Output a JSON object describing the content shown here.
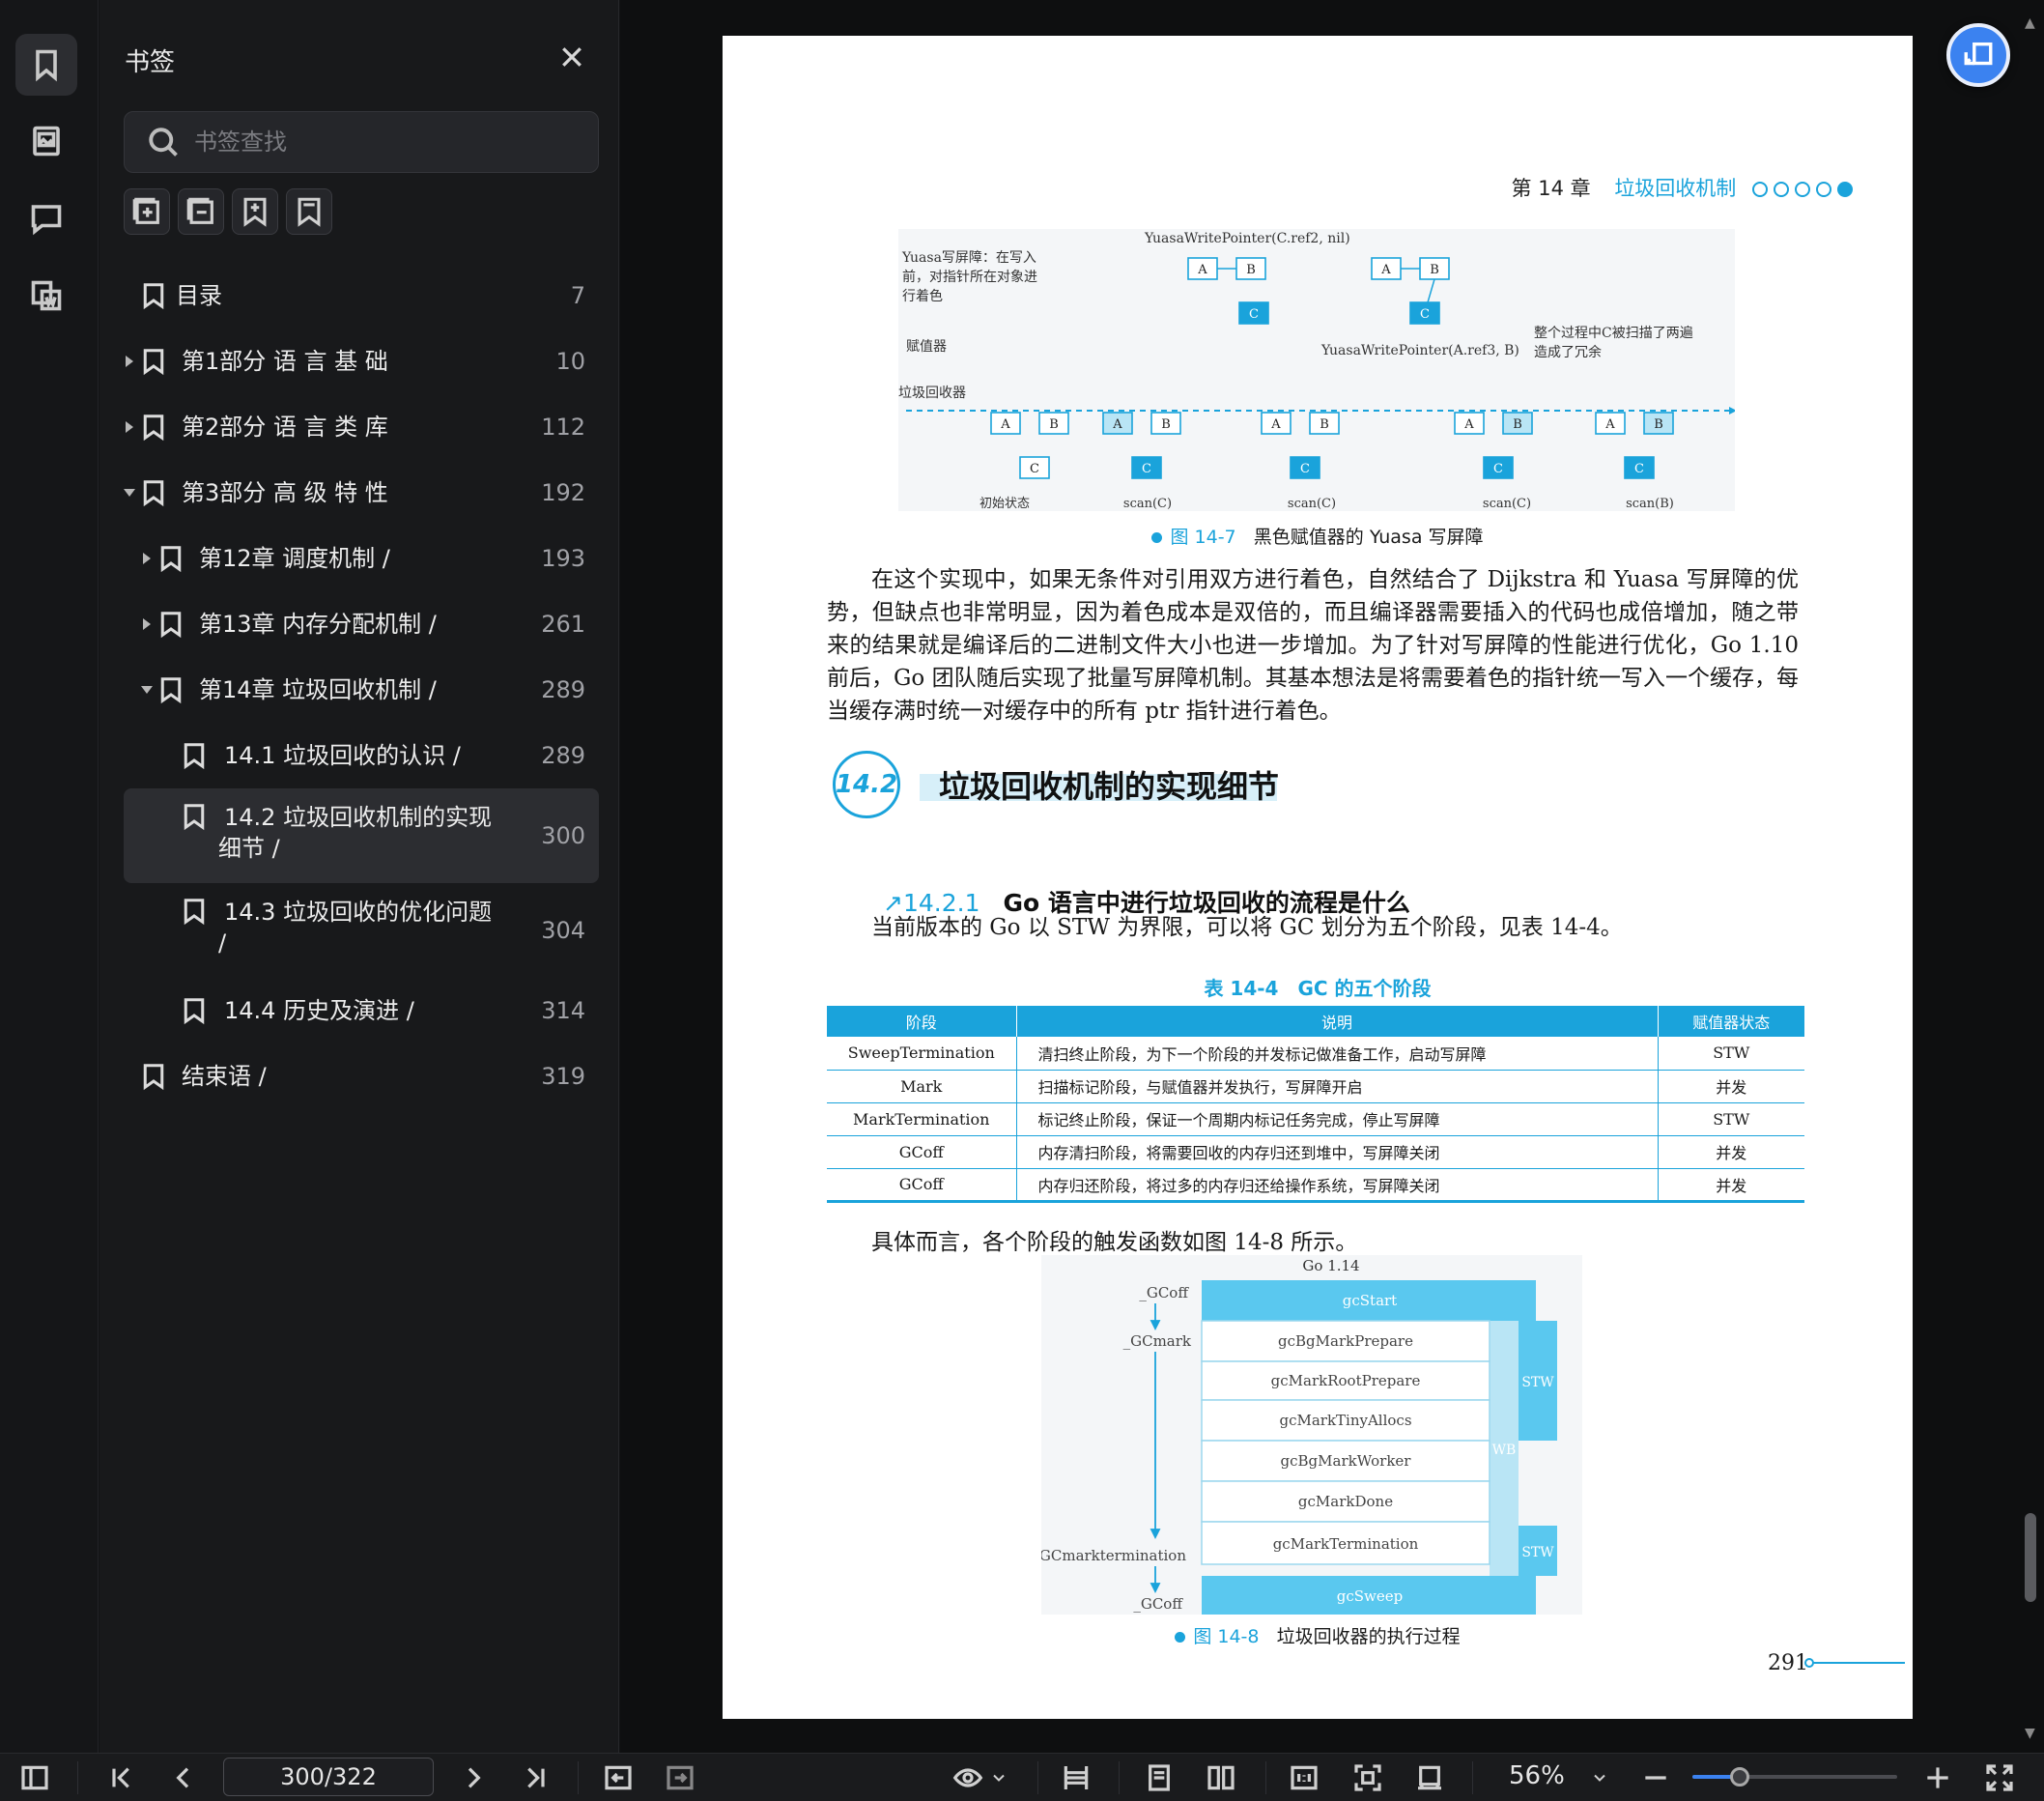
{
  "panel": {
    "title": "书签",
    "search_placeholder": "书签查找"
  },
  "bookmarks": [
    {
      "label": "目录",
      "page": "7",
      "level": 0,
      "expand": "none"
    },
    {
      "label": "第1部分 语 言 基 础",
      "page": "10",
      "level": 0,
      "expand": "collapsed"
    },
    {
      "label": "第2部分 语 言 类 库",
      "page": "112",
      "level": 0,
      "expand": "collapsed"
    },
    {
      "label": "第3部分 高 级 特 性",
      "page": "192",
      "level": 0,
      "expand": "expanded"
    },
    {
      "label": "第12章 调度机制 /",
      "page": "193",
      "level": 1,
      "expand": "collapsed"
    },
    {
      "label": "第13章 内存分配机制 /",
      "page": "261",
      "level": 1,
      "expand": "collapsed"
    },
    {
      "label": "第14章 垃圾回收机制 /",
      "page": "289",
      "level": 1,
      "expand": "expanded"
    },
    {
      "label": "14.1 垃圾回收的认识 /",
      "page": "289",
      "level": 2,
      "expand": "none"
    },
    {
      "label": "14.2 垃圾回收机制的实现细节 /",
      "page": "300",
      "level": 2,
      "expand": "none",
      "selected": true,
      "line1": "14.2 垃圾回收机制的实现",
      "line2": "细节 /"
    },
    {
      "label": "14.3 垃圾回收的优化问题 /",
      "page": "304",
      "level": 2,
      "expand": "none",
      "line1": "14.3 垃圾回收的优化问题",
      "line2": "/"
    },
    {
      "label": "14.4 历史及演进 /",
      "page": "314",
      "level": 2,
      "expand": "none"
    },
    {
      "label": "结束语 /",
      "page": "319",
      "level": 0,
      "expand": "none"
    }
  ],
  "page": {
    "chapter_no": "第 14 章",
    "chapter_title": "垃圾回收机制",
    "fig1": {
      "note_left": [
        "Yuasa写屏障：在写入",
        "前，对指针所在对象进",
        "行着色"
      ],
      "call_top": "YuasaWritePointer(C.ref2, nil)",
      "label_mutator": "赋值器",
      "call_mid": "YuasaWritePointer(A.ref3, B)",
      "note_right": [
        "整个过程中C被扫描了两遍",
        "造成了冗余"
      ],
      "label_gc": "垃圾回收器",
      "steps": [
        "初始状态",
        "scan(C)",
        "scan(C)",
        "scan(C)",
        "scan(B)"
      ],
      "caption_num": "图 14-7",
      "caption_text": "黑色赋值器的 Yuasa 写屏障"
    },
    "para1": "在这个实现中，如果无条件对引用双方进行着色，自然结合了 Dijkstra 和 Yuasa 写屏障的优势，但缺点也非常明显，因为着色成本是双倍的，而且编译器需要插入的代码也成倍增加，随之带来的结果就是编译后的二进制文件大小也进一步增加。为了针对写屏障的性能进行优化，Go 1.10 前后，Go 团队随后实现了批量写屏障机制。其基本想法是将需要着色的指针统一写入一个缓存，每当缓存满时统一对缓存中的所有 ptr 指针进行着色。",
    "section_no": "14.2",
    "section_title": "垃圾回收机制的实现细节",
    "subsection_no": "14.2.1",
    "subsection_title": "Go 语言中进行垃圾回收的流程是什么",
    "para2": "当前版本的 Go 以 STW 为界限，可以将 GC 划分为五个阶段，见表 14-4。",
    "table_caption": "表 14-4　GC 的五个阶段",
    "table_headers": [
      "阶段",
      "说明",
      "赋值器状态"
    ],
    "table_rows": [
      [
        "SweepTermination",
        "清扫终止阶段，为下一个阶段的并发标记做准备工作，启动写屏障",
        "STW"
      ],
      [
        "Mark",
        "扫描标记阶段，与赋值器并发执行，写屏障开启",
        "并发"
      ],
      [
        "MarkTermination",
        "标记终止阶段，保证一个周期内标记任务完成，停止写屏障",
        "STW"
      ],
      [
        "GCoff",
        "内存清扫阶段，将需要回收的内存归还到堆中，写屏障关闭",
        "并发"
      ],
      [
        "GCoff",
        "内存归还阶段，将过多的内存归还给操作系统，写屏障关闭",
        "并发"
      ]
    ],
    "para3": "具体而言，各个阶段的触发函数如图 14-8 所示。",
    "fig2": {
      "title": "Go 1.14",
      "states": [
        "_GCoff",
        "_GCmark",
        "_GCmarktermination",
        "_GCoff"
      ],
      "funcs": [
        "gcStart",
        "gcBgMarkPrepare",
        "gcMarkRootPrepare",
        "gcMarkTinyAllocs",
        "gcBgMarkWorker",
        "gcMarkDone",
        "gcMarkTermination",
        "gcSweep"
      ],
      "wb": "WB",
      "stw1": "STW",
      "stw2": "STW",
      "caption_num": "图 14-8",
      "caption_text": "垃圾回收器的执行过程"
    },
    "page_number": "291"
  },
  "toolbar": {
    "page_indicator": "300/322",
    "zoom": "56%",
    "zoom_fraction": 0.23
  }
}
